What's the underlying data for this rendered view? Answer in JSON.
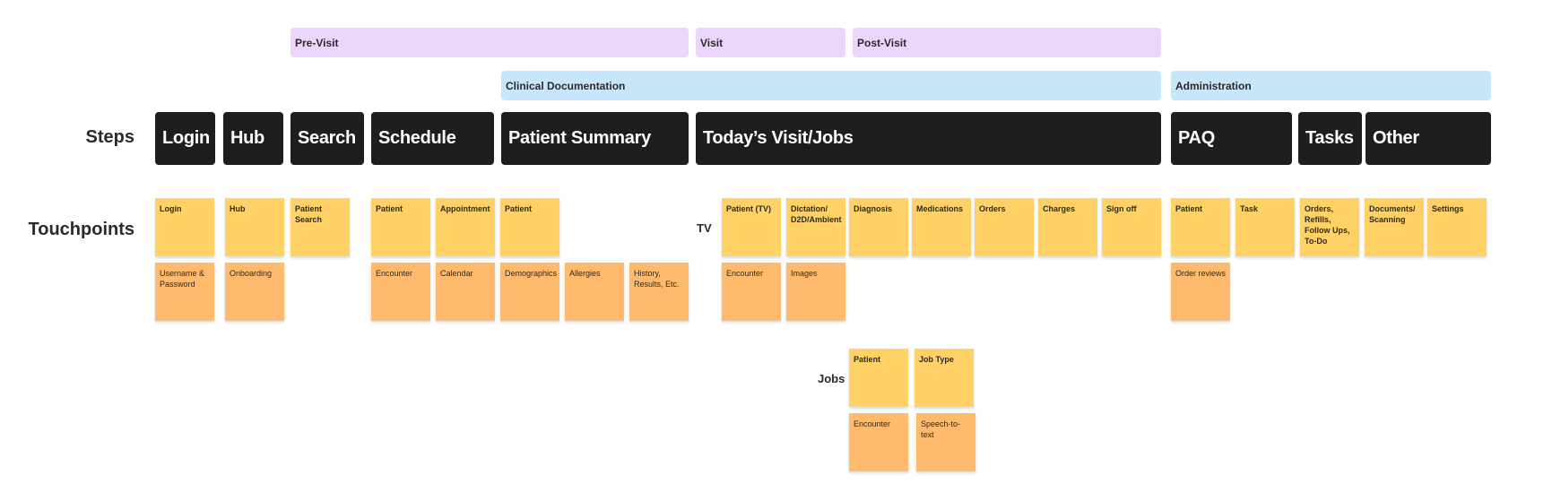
{
  "phases": [
    {
      "label": "Pre-Visit"
    },
    {
      "label": "Visit"
    },
    {
      "label": "Post-Visit"
    }
  ],
  "areas": [
    {
      "label": "Clinical Documentation"
    },
    {
      "label": "Administration"
    }
  ],
  "row_labels": {
    "steps": "Steps",
    "touchpoints": "Touchpoints",
    "tv": "TV",
    "jobs": "Jobs"
  },
  "steps": [
    {
      "label": "Login"
    },
    {
      "label": "Hub"
    },
    {
      "label": "Search"
    },
    {
      "label": "Schedule"
    },
    {
      "label": "Patient Summary"
    },
    {
      "label": "Today’s Visit/Jobs"
    },
    {
      "label": "PAQ"
    },
    {
      "label": "Tasks"
    },
    {
      "label": "Other"
    }
  ],
  "touchpoints": {
    "login": {
      "primary": "Login",
      "secondary": "Username & Password"
    },
    "hub": {
      "primary": "Hub",
      "secondary": "Onboarding"
    },
    "search": {
      "primary": "Patient Search"
    },
    "schedule": [
      {
        "primary": "Patient",
        "secondary": "Encounter"
      },
      {
        "primary": "Appointment",
        "secondary": "Calendar"
      }
    ],
    "patient_summary": {
      "primary": "Patient",
      "secondary": [
        "Demographics",
        "Allergies",
        "History, Results, Etc."
      ]
    },
    "tv": [
      {
        "primary": "Patient (TV)",
        "secondary": "Encounter"
      },
      {
        "primary": "Dictation/ D2D/Ambient",
        "secondary": "Images"
      },
      {
        "primary": "Diagnosis"
      },
      {
        "primary": "Medications"
      },
      {
        "primary": "Orders"
      },
      {
        "primary": "Charges"
      },
      {
        "primary": "Sign off"
      }
    ],
    "jobs": [
      {
        "primary": "Patient",
        "secondary": "Encounter"
      },
      {
        "primary": "Job Type",
        "secondary": "Speech-to-text"
      }
    ],
    "paq": {
      "primary": "Patient",
      "secondary": "Order reviews"
    },
    "tasks": [
      {
        "primary": "Task"
      },
      {
        "primary": "Orders, Refills, Follow Ups, To-Do"
      }
    ],
    "other": [
      {
        "primary": "Documents/ Scanning"
      },
      {
        "primary": "Settings"
      }
    ]
  },
  "colors": {
    "phase": "#ebd5fb",
    "area": "#c8e6fa",
    "step": "#1e1e1e",
    "sticky_primary": "#ffd167",
    "sticky_secondary": "#ffba6d"
  }
}
